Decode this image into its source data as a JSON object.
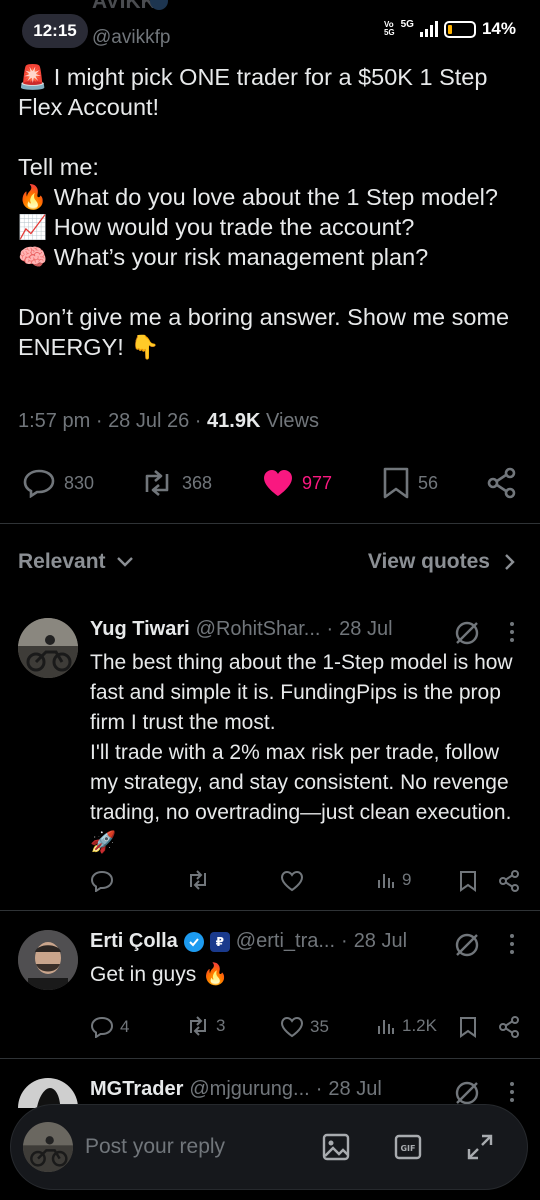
{
  "status_bar": {
    "time": "12:15",
    "network": "5G",
    "volte_top": "Vo",
    "volte_bottom": "5G",
    "battery": "14%"
  },
  "author": {
    "name": "AVIKK",
    "handle": "@avikkfp"
  },
  "tweet": {
    "paragraphs": [
      "🚨 I might pick ONE trader for a $50K 1 Step Flex Account!",
      "Tell me:\n🔥 What do you love about the 1 Step model?\n📈 How would you trade the account?\n🧠 What’s your risk management plan?",
      "Don’t give me a boring answer. Show me some ENERGY! 👇"
    ],
    "time": "1:57 pm",
    "date": "28 Jul 26",
    "views": "41.9K",
    "views_label": "Views",
    "sep": "·"
  },
  "actions": {
    "replies": "830",
    "reposts": "368",
    "likes": "977",
    "bookmarks": "56"
  },
  "filter": {
    "relevant": "Relevant",
    "view_quotes": "View quotes"
  },
  "replies": [
    {
      "name": "Yug Tiwari",
      "handle": "@RohitShar...",
      "date": "28 Jul",
      "text": "The best thing about the 1-Step model is how fast and simple it is. FundingPips is the prop firm I trust the most.\nI'll trade with a 2% max risk per trade, follow my strategy, and stay consistent. No revenge trading, no overtrading—just clean execution. 🚀",
      "replies": "",
      "reposts": "",
      "likes": "",
      "views": "9"
    },
    {
      "name": "Erti Çolla",
      "handle": "@erti_tra...",
      "date": "28 Jul",
      "text": "Get in guys 🔥",
      "replies": "4",
      "reposts": "3",
      "likes": "35",
      "views": "1.2K"
    },
    {
      "name": "MGTrader",
      "handle": "@mjgurung...",
      "date": "28 Jul"
    }
  ],
  "composer": {
    "placeholder": "Post your reply"
  },
  "colors": {
    "background": "#000000",
    "like_pink": "#f91880",
    "muted": "#71767b",
    "verified_blue": "#1d9bf0"
  }
}
